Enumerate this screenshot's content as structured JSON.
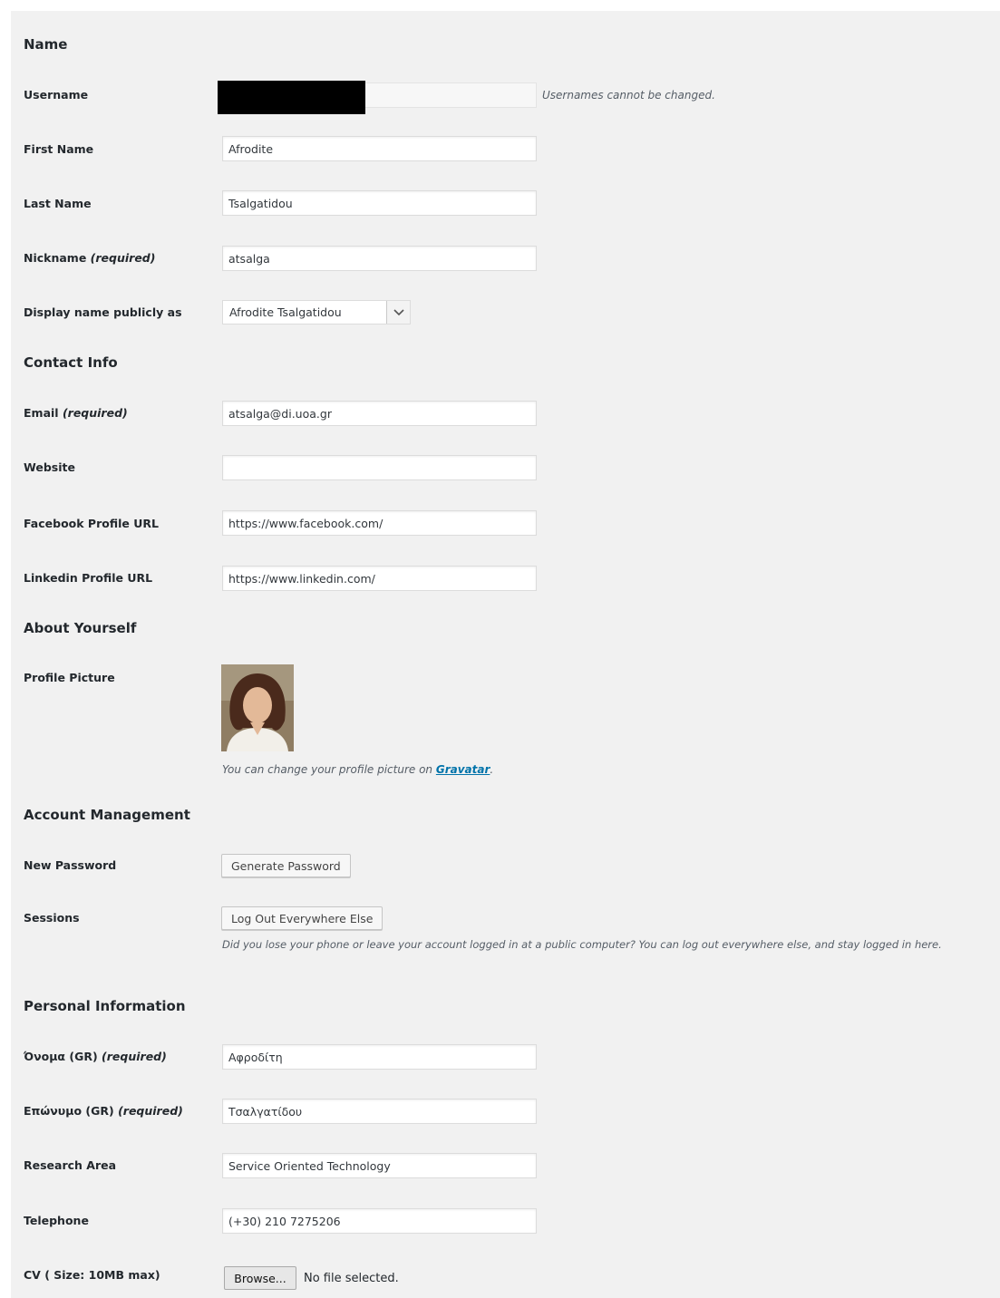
{
  "sections": {
    "name": "Name",
    "contact": "Contact Info",
    "about": "About Yourself",
    "account": "Account Management",
    "personal": "Personal Information"
  },
  "required_tag": "(required)",
  "fields": {
    "username": {
      "label": "Username",
      "value": "",
      "description": "Usernames cannot be changed."
    },
    "first_name": {
      "label": "First Name",
      "value": "Afrodite"
    },
    "last_name": {
      "label": "Last Name",
      "value": "Tsalgatidou"
    },
    "nickname": {
      "label": "Nickname",
      "value": "atsalga"
    },
    "display_name": {
      "label": "Display name publicly as",
      "value": "Afrodite Tsalgatidou"
    },
    "email": {
      "label": "Email",
      "value": "atsalga@di.uoa.gr"
    },
    "website": {
      "label": "Website",
      "value": ""
    },
    "facebook": {
      "label": "Facebook Profile URL",
      "value": "https://www.facebook.com/"
    },
    "linkedin": {
      "label": "Linkedin Profile URL",
      "value": "https://www.linkedin.com/"
    },
    "profile_picture": {
      "label": "Profile Picture",
      "description_prefix": "You can change your profile picture on ",
      "link_text": "Gravatar",
      "description_suffix": "."
    },
    "new_password": {
      "label": "New Password",
      "button": "Generate Password"
    },
    "sessions": {
      "label": "Sessions",
      "button": "Log Out Everywhere Else",
      "description": "Did you lose your phone or leave your account logged in at a public computer? You can log out everywhere else, and stay logged in here."
    },
    "name_gr": {
      "label": "Όνομα (GR)",
      "value": "Αφροδίτη"
    },
    "surname_gr": {
      "label": "Επώνυμο (GR)",
      "value": "Τσαλγατίδου"
    },
    "research_area": {
      "label": "Research Area",
      "value": "Service Oriented Technology"
    },
    "telephone": {
      "label": "Telephone",
      "value": "(+30) 210 7275206"
    },
    "cv": {
      "label": "CV ( Size: 10MB max)",
      "button": "Browse...",
      "status": "No file selected."
    }
  },
  "icons": {
    "select_arrow": "chevron-down-icon"
  },
  "colors": {
    "background": "#f1f1f1",
    "link": "#0073aa"
  }
}
